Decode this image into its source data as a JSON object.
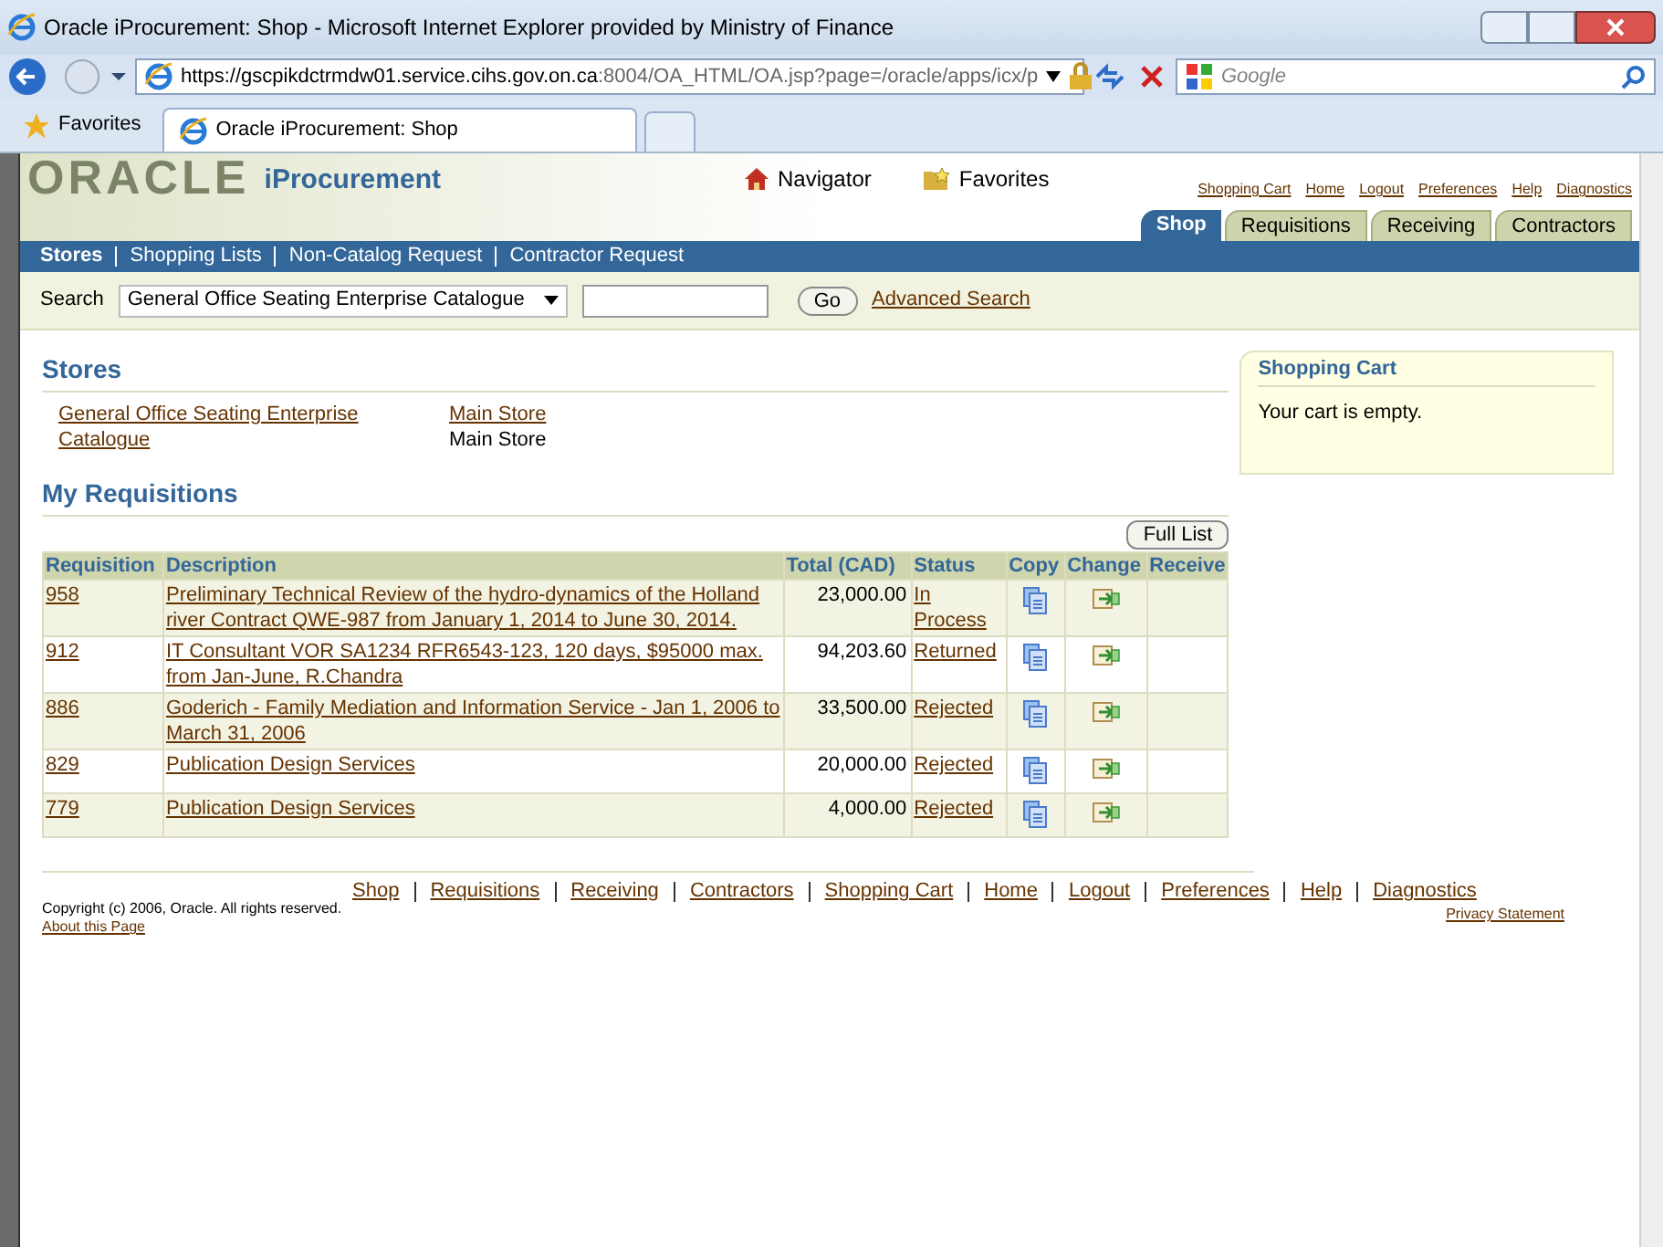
{
  "window": {
    "title": "Oracle iProcurement: Shop - Microsoft Internet Explorer provided by Ministry of Finance"
  },
  "address_bar": {
    "url_host": "https://gscpikdctrmdw01.service.cihs.gov.on.ca",
    "url_rest": ":8004/OA_HTML/OA.jsp?page=/oracle/apps/icx/p"
  },
  "search_box": {
    "placeholder": "Google"
  },
  "favorites_button": "Favorites",
  "browser_tabs": [
    {
      "label": "Oracle iProcurement: Shop",
      "selected": true
    }
  ],
  "header": {
    "logo": "ORACLE",
    "product": "iProcurement",
    "navigator": "Navigator",
    "favorites": "Favorites",
    "global_links": [
      "Shopping Cart",
      "Home",
      "Logout",
      "Preferences",
      "Help",
      "Diagnostics"
    ]
  },
  "tabs": [
    {
      "label": "Shop",
      "selected": true
    },
    {
      "label": "Requisitions",
      "selected": false
    },
    {
      "label": "Receiving",
      "selected": false
    },
    {
      "label": "Contractors",
      "selected": false
    }
  ],
  "subtabs": [
    {
      "label": "Stores",
      "selected": true
    },
    {
      "label": "Shopping Lists",
      "selected": false
    },
    {
      "label": "Non-Catalog Request",
      "selected": false
    },
    {
      "label": "Contractor Request",
      "selected": false
    }
  ],
  "search": {
    "label": "Search",
    "store": "General Office Seating Enterprise Catalogue",
    "go": "Go",
    "advanced": "Advanced Search"
  },
  "stores": {
    "title": "Stores",
    "items": [
      {
        "name": "General Office Seating Enterprise Catalogue",
        "store": "Main Store",
        "store_name": "Main Store"
      }
    ]
  },
  "requisitions": {
    "title": "My Requisitions",
    "full_list": "Full List",
    "columns": [
      "Requisition",
      "Description",
      "Total (CAD)",
      "Status",
      "Copy",
      "Change",
      "Receive"
    ],
    "rows": [
      {
        "number": "958",
        "description": "Preliminary Technical Review of the hydro-dynamics of the Holland river Contract QWE-987 from January 1, 2014 to June 30, 2014.",
        "total": "23,000.00",
        "status": "In Process"
      },
      {
        "number": "912",
        "description": "IT Consultant VOR SA1234 RFR6543-123, 120 days, $95000 max. from Jan-June, R.Chandra",
        "total": "94,203.60",
        "status": "Returned"
      },
      {
        "number": "886",
        "description": "Goderich - Family Mediation and Information Service - Jan 1, 2006 to March 31, 2006",
        "total": "33,500.00",
        "status": "Rejected"
      },
      {
        "number": "829",
        "description": "Publication Design Services",
        "total": "20,000.00",
        "status": "Rejected"
      },
      {
        "number": "779",
        "description": "Publication Design Services",
        "total": "4,000.00",
        "status": "Rejected"
      }
    ]
  },
  "shopping_cart": {
    "title": "Shopping Cart",
    "message": "Your cart is empty."
  },
  "footer": {
    "links": [
      "Shop",
      "Requisitions",
      "Receiving",
      "Contractors",
      "Shopping Cart",
      "Home",
      "Logout",
      "Preferences",
      "Help",
      "Diagnostics"
    ],
    "copyright": "Copyright (c) 2006, Oracle. All rights reserved.",
    "about": "About this Page",
    "privacy": "Privacy Statement"
  }
}
